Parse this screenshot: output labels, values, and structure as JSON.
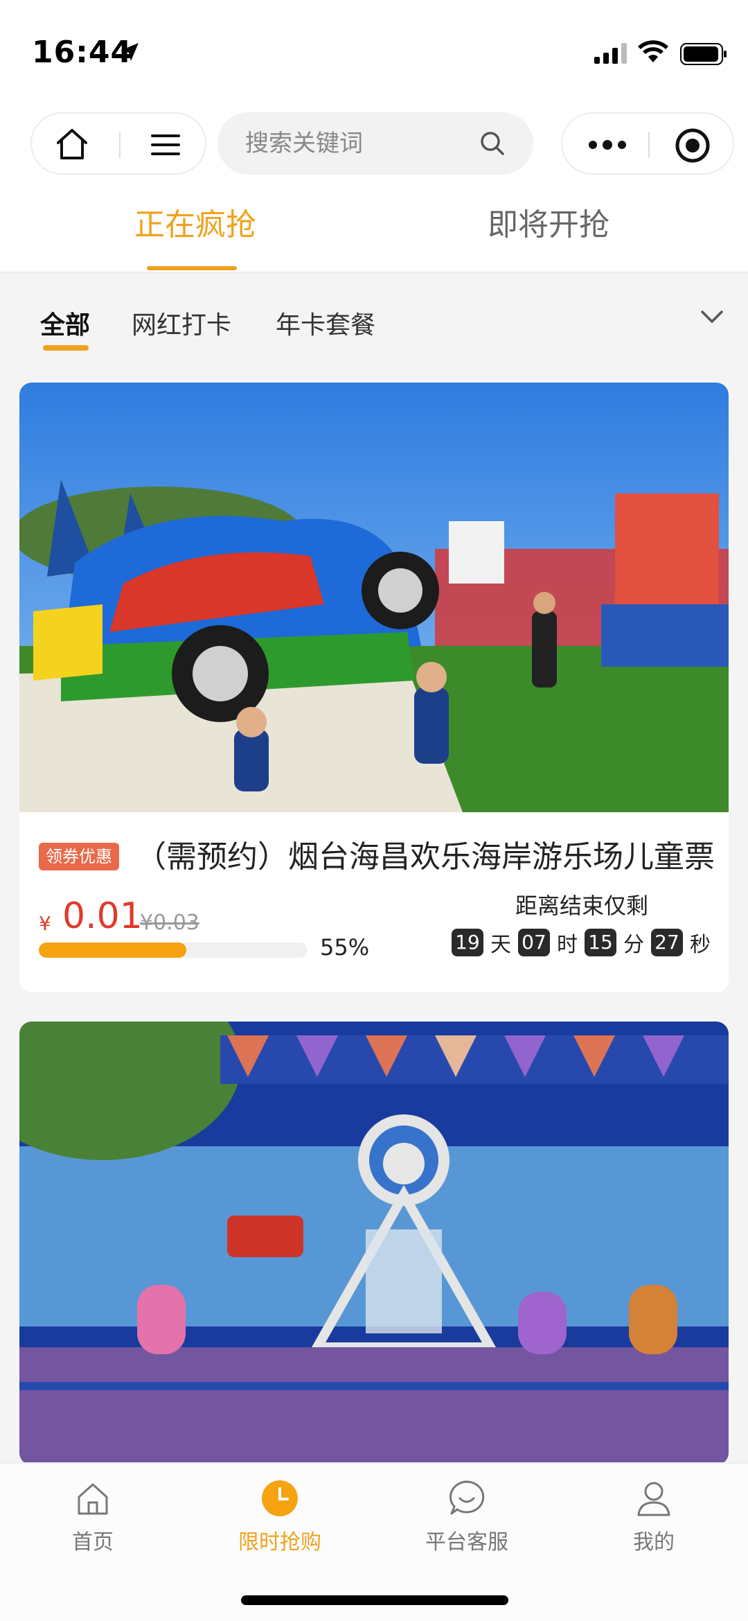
{
  "status_bar": {
    "time": "16:44"
  },
  "nav": {
    "search_placeholder": "搜索关键词"
  },
  "main_tabs": [
    {
      "label": "正在疯抢",
      "active": true
    },
    {
      "label": "即将开抢",
      "active": false
    }
  ],
  "categories": [
    {
      "label": "全部",
      "active": true
    },
    {
      "label": "网红打卡",
      "active": false
    },
    {
      "label": "年卡套餐",
      "active": false
    }
  ],
  "products": [
    {
      "tag": "领券优惠",
      "title": "（需预约）烟台海昌欢乐海岸游乐场儿童票",
      "currency": "¥",
      "price": "0.01",
      "original_price": "¥0.03",
      "progress": 0.55,
      "progress_text": "55%",
      "countdown_label": "距离结束仅剩",
      "countdown": {
        "days": "19",
        "hours": "07",
        "minutes": "15",
        "seconds": "27"
      },
      "countdown_units": {
        "days": "天",
        "hours": "时",
        "minutes": "分",
        "seconds": "秒"
      }
    }
  ],
  "bottom_nav": [
    {
      "label": "首页",
      "icon": "home-icon",
      "active": false
    },
    {
      "label": "限时抢购",
      "icon": "clock-icon",
      "active": true
    },
    {
      "label": "平台客服",
      "icon": "chat-icon",
      "active": false
    },
    {
      "label": "我的",
      "icon": "user-icon",
      "active": false
    }
  ],
  "colors": {
    "accent": "#f0a21e",
    "price": "#e03a2a",
    "coupon": "#e96a4a"
  }
}
